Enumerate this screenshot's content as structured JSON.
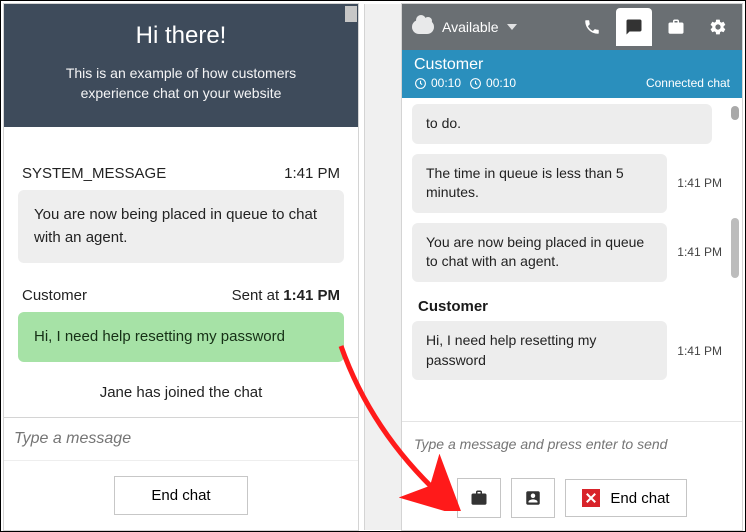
{
  "customer_widget": {
    "promo_title": "Hi there!",
    "promo_sub": "This is an example of how customers experience chat on your website",
    "system": {
      "label": "SYSTEM_MESSAGE",
      "timestamp": "1:41 PM",
      "body": "You are now being placed in queue to chat with an agent."
    },
    "customer": {
      "label": "Customer",
      "sent_prefix": "Sent at ",
      "timestamp": "1:41 PM",
      "body": "Hi, I need help resetting my password"
    },
    "joined_notice": "Jane has joined the chat",
    "input_placeholder": "Type a message",
    "end_label": "End chat"
  },
  "agent_console": {
    "status_text": "Available",
    "customer_name": "Customer",
    "timer_a": "00:10",
    "timer_b": "00:10",
    "connection_state": "Connected chat",
    "messages": [
      {
        "body": "to do.",
        "ts": ""
      },
      {
        "body": "The time in queue is less than 5 minutes.",
        "ts": "1:41 PM"
      },
      {
        "body": "You are now being placed in queue to chat with an agent.",
        "ts": "1:41 PM"
      }
    ],
    "customer_sender_label": "Customer",
    "customer_message": {
      "body": "Hi, I need help resetting my password",
      "ts": "1:41 PM"
    },
    "input_placeholder": "Type a message and press enter to send",
    "end_label": "End chat"
  }
}
